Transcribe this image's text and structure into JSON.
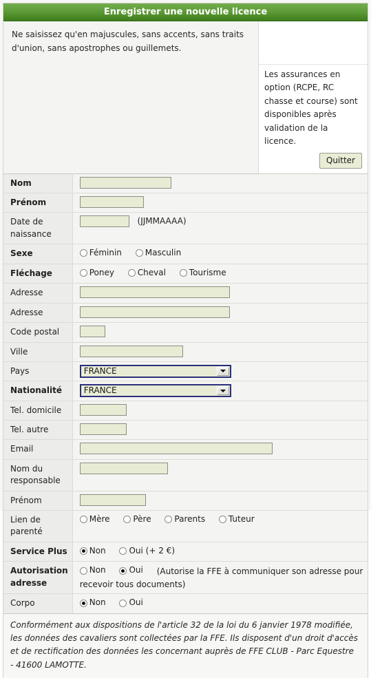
{
  "window": {
    "title": "Enregistrer une nouvelle licence"
  },
  "notice": {
    "text": "Ne saisissez qu'en majuscules, sans accents, sans traits d'union, sans apostrophes ou guillemets."
  },
  "sidepanel": {
    "insurance_text": "Les assurances en option (RCPE, RC chasse et course) sont disponibles après validation de la licence.",
    "quit_label": "Quitter"
  },
  "form": {
    "nom": {
      "label": "Nom",
      "value": ""
    },
    "prenom": {
      "label": "Prénom",
      "value": ""
    },
    "date_naissance": {
      "label": "Date de naissance",
      "value": "",
      "hint": "(JJMMAAAA)"
    },
    "sexe": {
      "label": "Sexe",
      "options": [
        {
          "label": "Féminin",
          "checked": false
        },
        {
          "label": "Masculin",
          "checked": false
        }
      ]
    },
    "flechage": {
      "label": "Fléchage",
      "options": [
        {
          "label": "Poney",
          "checked": false
        },
        {
          "label": "Cheval",
          "checked": false
        },
        {
          "label": "Tourisme",
          "checked": false
        }
      ]
    },
    "adresse1": {
      "label": "Adresse",
      "value": ""
    },
    "adresse2": {
      "label": "Adresse",
      "value": ""
    },
    "code_postal": {
      "label": "Code postal",
      "value": ""
    },
    "ville": {
      "label": "Ville",
      "value": ""
    },
    "pays": {
      "label": "Pays",
      "value": "FRANCE"
    },
    "nationalite": {
      "label": "Nationalité",
      "value": "FRANCE"
    },
    "tel_domicile": {
      "label": "Tel. domicile",
      "value": ""
    },
    "tel_autre": {
      "label": "Tel. autre",
      "value": ""
    },
    "email": {
      "label": "Email",
      "value": ""
    },
    "nom_responsable": {
      "label": "Nom du responsable",
      "value": ""
    },
    "prenom_responsable": {
      "label": "Prénom",
      "value": ""
    },
    "lien_parente": {
      "label": "Lien de parenté",
      "options": [
        {
          "label": "Mère",
          "checked": false
        },
        {
          "label": "Père",
          "checked": false
        },
        {
          "label": "Parents",
          "checked": false
        },
        {
          "label": "Tuteur",
          "checked": false
        }
      ]
    },
    "service_plus": {
      "label": "Service Plus",
      "options": [
        {
          "label": "Non",
          "checked": true
        },
        {
          "label": "Oui (+ 2 €)",
          "checked": false
        }
      ]
    },
    "autorisation_adresse": {
      "label": "Autorisation adresse",
      "options": [
        {
          "label": "Non",
          "checked": false
        },
        {
          "label": "Oui",
          "checked": true
        }
      ],
      "note": "(Autorise la FFE à communiquer son adresse pour recevoir tous documents)"
    },
    "corpo": {
      "label": "Corpo",
      "options": [
        {
          "label": "Non",
          "checked": true
        },
        {
          "label": "Oui",
          "checked": false
        }
      ]
    }
  },
  "footer": {
    "text": "Conformément aux dispositions de l'article 32 de la loi du 6 janvier 1978 modifiée, les données des cavaliers sont collectées par la FFE. Ils disposent d'un droit d'accès et de rectification des données les concernant auprès de FFE CLUB - Parc Equestre - 41600 LAMOTTE."
  }
}
